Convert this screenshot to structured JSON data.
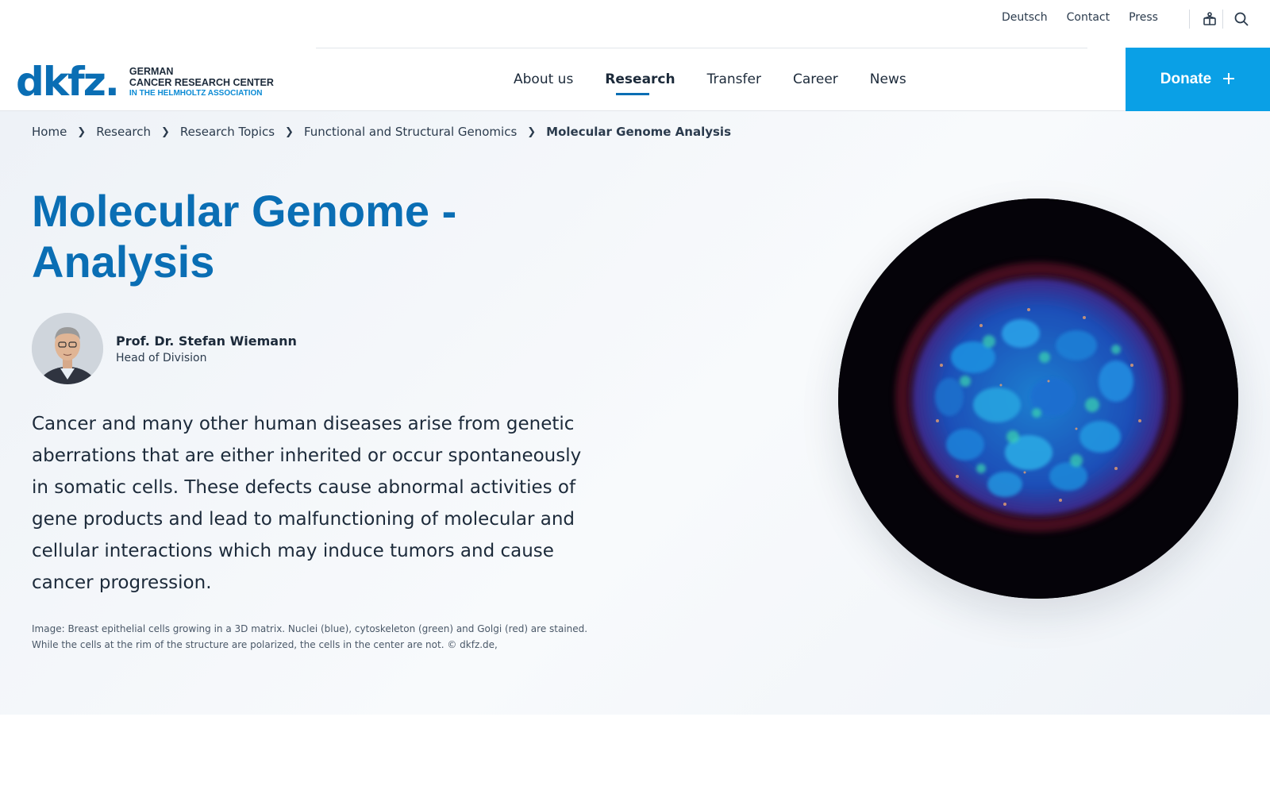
{
  "utility": {
    "links": [
      "Deutsch",
      "Contact",
      "Press"
    ],
    "icons": [
      "accessibility-icon",
      "search-icon"
    ]
  },
  "logo": {
    "mark": "dkfz.",
    "line1": "GERMAN",
    "line2": "CANCER RESEARCH CENTER",
    "line3": "IN THE HELMHOLTZ ASSOCIATION"
  },
  "nav": {
    "items": [
      "About us",
      "Research",
      "Transfer",
      "Career",
      "News"
    ],
    "active": "Research"
  },
  "donate": {
    "label": "Donate",
    "icon": "plus-icon"
  },
  "breadcrumb": [
    "Home",
    "Research",
    "Research Topics",
    "Functional and Structural Genomics",
    "Molecular Genome Analysis"
  ],
  "page": {
    "title": "Molecular Genome - Analysis",
    "person_name": "Prof. Dr. Stefan Wiemann",
    "person_role": "Head of Division",
    "lead": "Cancer and many other human diseases arise from genetic aberrations that are either inherited or occur spontaneously in somatic cells. These defects cause abnormal activities of gene products and lead to malfunctioning of molecular and cellular interactions which may induce tumors and cause cancer progression.",
    "caption": "Image: Breast epithelial cells growing in a 3D matrix. Nuclei (blue), cytoskeleton (green) and Golgi (red) are stained. While the cells at the rim of the structure are polarized, the cells in the center are not. © dkfz.de,"
  },
  "colors": {
    "brand": "#0a6eb4",
    "donate": "#0aa0e6"
  }
}
